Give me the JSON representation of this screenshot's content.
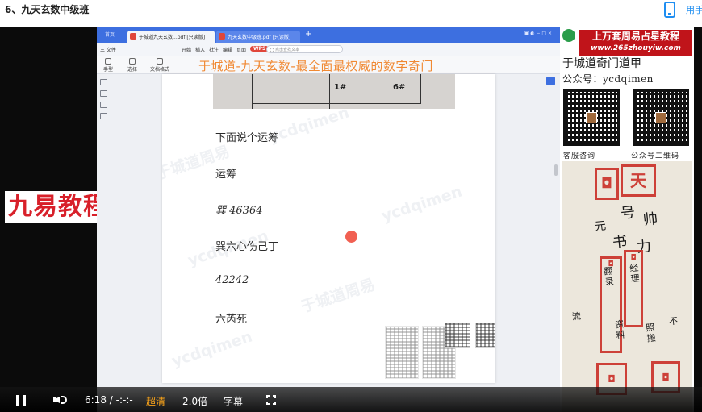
{
  "page": {
    "title": "6、九天玄数中级班",
    "mobile_link": "用手"
  },
  "wps": {
    "home_label": "首页",
    "tabs": [
      "于城道九天玄数...pdf [只读版]",
      "九天玄数中级班.pdf [只读版]"
    ],
    "menu": [
      "三 文件",
      "开始",
      "插入",
      "批注",
      "编辑",
      "页面",
      "保护",
      "转换",
      "特色应用"
    ],
    "menu_highlight": "WPS",
    "search_placeholder": "点击查找文本",
    "toolbar": [
      "手型",
      "选择",
      "文档格式",
      "文档转换"
    ],
    "watermark_title": "于城道-九天玄数-最全面最权威的数字奇门",
    "table_cells": [
      "1#",
      "6#"
    ],
    "doc_lines": [
      "下面说个运筹",
      "运筹",
      "巽 46364",
      "巽六心伤己丁",
      "42242",
      "六芮死"
    ],
    "watermark_text": "ycdqimen",
    "watermark_cn": "于城道周易"
  },
  "overlay": {
    "logo_text": "九易教程"
  },
  "ad": {
    "red_title": "上万套周易占星教程",
    "red_url": "www.265zhouyiw.com",
    "line1": "于城道奇门道甲",
    "line2": "公众号：ycdqimen",
    "caption_left": "客服咨询",
    "caption_right": "公众号二维码",
    "seal_top": "天",
    "hand_lines": [
      "元",
      "号",
      "帅",
      "书",
      "力",
      "经理",
      "资料",
      "照搬",
      "翻录",
      "不",
      "流"
    ]
  },
  "controls": {
    "time": "6:18 / -:-:-",
    "quality": "超清",
    "speed": "2.0倍",
    "subtitle": "字幕"
  },
  "colors": {
    "wps_blue": "#3d6fe0",
    "accent_red": "#c0141a",
    "watermark_orange": "#f07a18",
    "quality_orange": "#f7a21a",
    "link_blue": "#1f8ef1"
  }
}
